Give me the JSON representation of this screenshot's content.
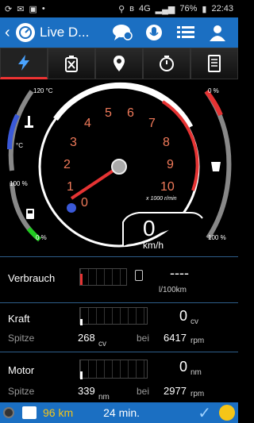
{
  "status": {
    "battery": "76%",
    "time": "22:43",
    "network": "4G"
  },
  "appbar": {
    "title": "Live D...",
    "back_glyph": "‹"
  },
  "tabs": [
    {
      "name": "dashboard",
      "icon": "lightning-icon",
      "active": true
    },
    {
      "name": "fuel",
      "icon": "fuel-can-icon",
      "active": false
    },
    {
      "name": "location",
      "icon": "map-pin-icon",
      "active": false
    },
    {
      "name": "timer",
      "icon": "stopwatch-icon",
      "active": false
    },
    {
      "name": "log",
      "icon": "document-icon",
      "active": false
    }
  ],
  "gauge": {
    "rpm_ticks": [
      "0",
      "1",
      "2",
      "3",
      "4",
      "5",
      "6",
      "7",
      "8",
      "9",
      "10"
    ],
    "rpm_unit": "x 1000 r/min",
    "speed_value": "0",
    "speed_unit": "km/h",
    "temp_top": "120 °C",
    "temp_bottom": "°C",
    "fuel_top": "100 %",
    "fuel_bottom": "0 %",
    "right_top": "0 %",
    "right_bottom": "100 %"
  },
  "consumption": {
    "label": "Verbrauch",
    "value": "----",
    "unit": "l/100km"
  },
  "power": {
    "label": "Kraft",
    "value": "0",
    "unit": "cv",
    "peak_label": "Spitze",
    "peak_value": "268",
    "peak_unit": "cv",
    "at_label": "bei",
    "at_value": "6417",
    "at_unit": "rpm"
  },
  "engine": {
    "label": "Motor",
    "value": "0",
    "unit": "nm",
    "peak_label": "Spitze",
    "peak_value": "339",
    "peak_unit": "nm",
    "at_label": "bei",
    "at_value": "2977",
    "at_unit": "rpm"
  },
  "bottombar": {
    "distance": "96 km",
    "duration": "24 min."
  },
  "colors": {
    "accent": "#1b6fc2",
    "red": "#e53333",
    "green": "#22cc22"
  }
}
